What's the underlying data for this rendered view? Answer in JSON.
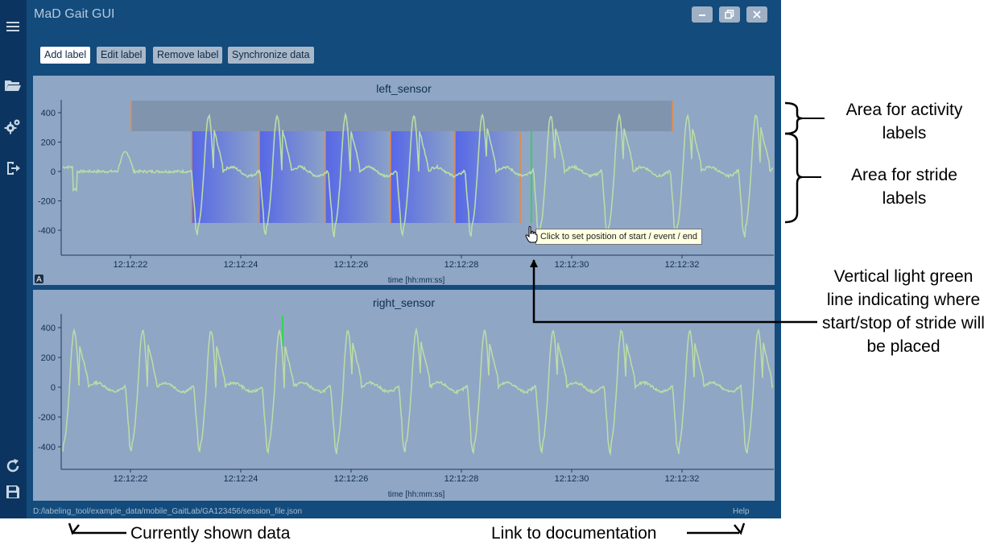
{
  "app": {
    "title": "MaD Gait GUI"
  },
  "sidebar": {
    "icons": [
      "menu-icon",
      "open-folder-icon",
      "settings-gears-icon",
      "export-icon",
      "refresh-icon",
      "save-icon"
    ]
  },
  "toolbar": {
    "add_label": "Add label",
    "edit_label": "Edit label",
    "remove_label": "Remove label",
    "sync_label": "Synchronize data"
  },
  "plots": [
    {
      "title": "left_sensor",
      "xlabel": "time [hh:mm:ss]",
      "yticks": [
        "400",
        "200",
        "0",
        "-200",
        "-400"
      ],
      "xticks": [
        "12:12:22",
        "12:12:24",
        "12:12:26",
        "12:12:28",
        "12:12:30",
        "12:12:32"
      ],
      "auto_range_badge": "A"
    },
    {
      "title": "right_sensor",
      "xlabel": "time [hh:mm:ss]",
      "yticks": [
        "400",
        "200",
        "0",
        "-200",
        "-400"
      ],
      "xticks": [
        "12:12:22",
        "12:12:24",
        "12:12:26",
        "12:12:28",
        "12:12:30",
        "12:12:32"
      ]
    }
  ],
  "tooltip": "Click to set position of start / event / end",
  "statusbar": {
    "file_path": "D:/labeling_tool/example_data/mobile_GaitLab/GA123456/session_file.json",
    "help": "Help"
  },
  "annotations": {
    "activity_area": "Area for activity labels",
    "stride_area": "Area for stride labels",
    "green_line": "Vertical light green line indicating where start/stop of stride will be placed",
    "current_data": "Currently shown data",
    "documentation_link": "Link to documentation"
  },
  "colors": {
    "signal": "#b9dca6",
    "activity_band": "#7f91a9",
    "stride_fill": "#5667e8",
    "label_border": "#e8893a",
    "cursor_line": "#38d05a"
  }
}
